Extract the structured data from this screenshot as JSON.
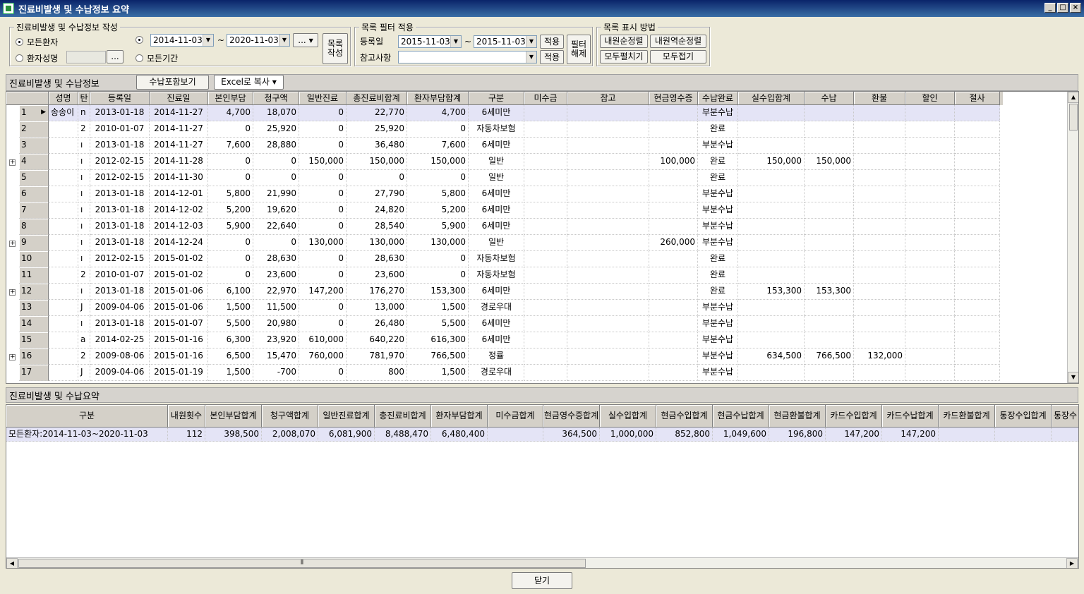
{
  "window": {
    "title": "진료비발생 및 수납정보 요약",
    "buttons": [
      "_",
      "□",
      "×"
    ]
  },
  "create_group": {
    "label": "진료비발생 및 수납정보 작성",
    "all_patients": "모든환자",
    "patient_name": "환자성명",
    "browse": "...",
    "date_from": "2014-11-03",
    "date_to": "2020-11-03",
    "tilde": "~",
    "range_btn": "...",
    "all_period": "모든기간",
    "create_btn": "목록\n작성"
  },
  "filter_group": {
    "label": "목록 필터 적용",
    "reg_label": "등록일",
    "reg_from": "2015-11-03",
    "reg_to": "2015-11-03",
    "tilde": "~",
    "apply1": "적용",
    "note_label": "참고사항",
    "note_value": "",
    "apply2": "적용",
    "clear_btn": "필터\n해제"
  },
  "display_group": {
    "label": "목록 표시 방법",
    "asc": "내원순정렬",
    "desc": "내원역순정렬",
    "expand_all": "모두펼치기",
    "collapse_all": "모두접기"
  },
  "detail_panel": {
    "title": "진료비발생 및 수납정보",
    "include_payment": "수납포함보기",
    "excel": "Excel로 복사",
    "columns": [
      "성명",
      "탄",
      "등록일",
      "진료일",
      "본인부담",
      "청구액",
      "일반진료",
      "총진료비합계",
      "환자부담합계",
      "구분",
      "미수금",
      "참고",
      "현금영수증",
      "수납완료",
      "실수입합계",
      "수납",
      "환불",
      "할인",
      "절사"
    ],
    "rows": [
      {
        "no": "1",
        "name": "송송이",
        "g": "n",
        "reg": "2013-01-18",
        "visit": "2014-11-27",
        "self": "4,700",
        "claim": "18,070",
        "general": "0",
        "total": "22,770",
        "patient": "4,700",
        "type": "6세미만",
        "unpaid": "",
        "ref": "",
        "receipt": "",
        "done": "부분수납",
        "income": "",
        "paid": "",
        "refund": "",
        "discount": "",
        "cut": "",
        "expand": false
      },
      {
        "no": "2",
        "name": "",
        "g": "2",
        "reg": "2010-01-07",
        "visit": "2014-11-27",
        "self": "0",
        "claim": "25,920",
        "general": "0",
        "total": "25,920",
        "patient": "0",
        "type": "자동차보험",
        "unpaid": "",
        "ref": "",
        "receipt": "",
        "done": "완료",
        "income": "",
        "paid": "",
        "refund": "",
        "discount": "",
        "cut": "",
        "expand": false
      },
      {
        "no": "3",
        "name": "",
        "g": "ı",
        "reg": "2013-01-18",
        "visit": "2014-11-27",
        "self": "7,600",
        "claim": "28,880",
        "general": "0",
        "total": "36,480",
        "patient": "7,600",
        "type": "6세미만",
        "unpaid": "",
        "ref": "",
        "receipt": "",
        "done": "부분수납",
        "income": "",
        "paid": "",
        "refund": "",
        "discount": "",
        "cut": "",
        "expand": false
      },
      {
        "no": "4",
        "name": "",
        "g": "ı",
        "reg": "2012-02-15",
        "visit": "2014-11-28",
        "self": "0",
        "claim": "0",
        "general": "150,000",
        "total": "150,000",
        "patient": "150,000",
        "type": "일반",
        "unpaid": "",
        "ref": "",
        "receipt": "100,000",
        "done": "완료",
        "income": "150,000",
        "paid": "150,000",
        "refund": "",
        "discount": "",
        "cut": "",
        "expand": true
      },
      {
        "no": "5",
        "name": "",
        "g": "ı",
        "reg": "2012-02-15",
        "visit": "2014-11-30",
        "self": "0",
        "claim": "0",
        "general": "0",
        "total": "0",
        "patient": "0",
        "type": "일반",
        "unpaid": "",
        "ref": "",
        "receipt": "",
        "done": "완료",
        "income": "",
        "paid": "",
        "refund": "",
        "discount": "",
        "cut": "",
        "expand": false
      },
      {
        "no": "6",
        "name": "",
        "g": "ı",
        "reg": "2013-01-18",
        "visit": "2014-12-01",
        "self": "5,800",
        "claim": "21,990",
        "general": "0",
        "total": "27,790",
        "patient": "5,800",
        "type": "6세미만",
        "unpaid": "",
        "ref": "",
        "receipt": "",
        "done": "부분수납",
        "income": "",
        "paid": "",
        "refund": "",
        "discount": "",
        "cut": "",
        "expand": false
      },
      {
        "no": "7",
        "name": "",
        "g": "ı",
        "reg": "2013-01-18",
        "visit": "2014-12-02",
        "self": "5,200",
        "claim": "19,620",
        "general": "0",
        "total": "24,820",
        "patient": "5,200",
        "type": "6세미만",
        "unpaid": "",
        "ref": "",
        "receipt": "",
        "done": "부분수납",
        "income": "",
        "paid": "",
        "refund": "",
        "discount": "",
        "cut": "",
        "expand": false
      },
      {
        "no": "8",
        "name": "",
        "g": "ı",
        "reg": "2013-01-18",
        "visit": "2014-12-03",
        "self": "5,900",
        "claim": "22,640",
        "general": "0",
        "total": "28,540",
        "patient": "5,900",
        "type": "6세미만",
        "unpaid": "",
        "ref": "",
        "receipt": "",
        "done": "부분수납",
        "income": "",
        "paid": "",
        "refund": "",
        "discount": "",
        "cut": "",
        "expand": false
      },
      {
        "no": "9",
        "name": "",
        "g": "ı",
        "reg": "2013-01-18",
        "visit": "2014-12-24",
        "self": "0",
        "claim": "0",
        "general": "130,000",
        "total": "130,000",
        "patient": "130,000",
        "type": "일반",
        "unpaid": "",
        "ref": "",
        "receipt": "260,000",
        "done": "부분수납",
        "income": "",
        "paid": "",
        "refund": "",
        "discount": "",
        "cut": "",
        "expand": true
      },
      {
        "no": "10",
        "name": "",
        "g": "ı",
        "reg": "2012-02-15",
        "visit": "2015-01-02",
        "self": "0",
        "claim": "28,630",
        "general": "0",
        "total": "28,630",
        "patient": "0",
        "type": "자동차보험",
        "unpaid": "",
        "ref": "",
        "receipt": "",
        "done": "완료",
        "income": "",
        "paid": "",
        "refund": "",
        "discount": "",
        "cut": "",
        "expand": false
      },
      {
        "no": "11",
        "name": "",
        "g": "2",
        "reg": "2010-01-07",
        "visit": "2015-01-02",
        "self": "0",
        "claim": "23,600",
        "general": "0",
        "total": "23,600",
        "patient": "0",
        "type": "자동차보험",
        "unpaid": "",
        "ref": "",
        "receipt": "",
        "done": "완료",
        "income": "",
        "paid": "",
        "refund": "",
        "discount": "",
        "cut": "",
        "expand": false
      },
      {
        "no": "12",
        "name": "",
        "g": "ı",
        "reg": "2013-01-18",
        "visit": "2015-01-06",
        "self": "6,100",
        "claim": "22,970",
        "general": "147,200",
        "total": "176,270",
        "patient": "153,300",
        "type": "6세미만",
        "unpaid": "",
        "ref": "",
        "receipt": "",
        "done": "완료",
        "income": "153,300",
        "paid": "153,300",
        "refund": "",
        "discount": "",
        "cut": "",
        "expand": true
      },
      {
        "no": "13",
        "name": "",
        "g": "J",
        "reg": "2009-04-06",
        "visit": "2015-01-06",
        "self": "1,500",
        "claim": "11,500",
        "general": "0",
        "total": "13,000",
        "patient": "1,500",
        "type": "경로우대",
        "unpaid": "",
        "ref": "",
        "receipt": "",
        "done": "부분수납",
        "income": "",
        "paid": "",
        "refund": "",
        "discount": "",
        "cut": "",
        "expand": false
      },
      {
        "no": "14",
        "name": "",
        "g": "ı",
        "reg": "2013-01-18",
        "visit": "2015-01-07",
        "self": "5,500",
        "claim": "20,980",
        "general": "0",
        "total": "26,480",
        "patient": "5,500",
        "type": "6세미만",
        "unpaid": "",
        "ref": "",
        "receipt": "",
        "done": "부분수납",
        "income": "",
        "paid": "",
        "refund": "",
        "discount": "",
        "cut": "",
        "expand": false
      },
      {
        "no": "15",
        "name": "",
        "g": "a",
        "reg": "2014-02-25",
        "visit": "2015-01-16",
        "self": "6,300",
        "claim": "23,920",
        "general": "610,000",
        "total": "640,220",
        "patient": "616,300",
        "type": "6세미만",
        "unpaid": "",
        "ref": "",
        "receipt": "",
        "done": "부분수납",
        "income": "",
        "paid": "",
        "refund": "",
        "discount": "",
        "cut": "",
        "expand": false
      },
      {
        "no": "16",
        "name": "",
        "g": "2",
        "reg": "2009-08-06",
        "visit": "2015-01-16",
        "self": "6,500",
        "claim": "15,470",
        "general": "760,000",
        "total": "781,970",
        "patient": "766,500",
        "type": "정률",
        "unpaid": "",
        "ref": "",
        "receipt": "",
        "done": "부분수납",
        "income": "634,500",
        "paid": "766,500",
        "refund": "132,000",
        "discount": "",
        "cut": "",
        "expand": true
      },
      {
        "no": "17",
        "name": "",
        "g": "J",
        "reg": "2009-04-06",
        "visit": "2015-01-19",
        "self": "1,500",
        "claim": "-700",
        "general": "0",
        "total": "800",
        "patient": "1,500",
        "type": "경로우대",
        "unpaid": "",
        "ref": "",
        "receipt": "",
        "done": "부분수납",
        "income": "",
        "paid": "",
        "refund": "",
        "discount": "",
        "cut": "",
        "expand": false
      }
    ]
  },
  "summary_panel": {
    "title": "진료비발생 및 수납요약",
    "columns": [
      "구분",
      "내원횟수",
      "본인부담합계",
      "청구액합계",
      "일반진료합계",
      "총진료비합계",
      "환자부담합계",
      "미수금합계",
      "현금영수증합계",
      "실수입합계",
      "현금수입합계",
      "현금수납합계",
      "현금환불합계",
      "카드수입합계",
      "카드수납합계",
      "카드환불합계",
      "통장수입합계",
      "통장수"
    ],
    "row": [
      "모든환자:2014-11-03~2020-11-03",
      "112",
      "398,500",
      "2,008,070",
      "6,081,900",
      "8,488,470",
      "6,480,400",
      "",
      "364,500",
      "1,000,000",
      "852,800",
      "1,049,600",
      "196,800",
      "147,200",
      "147,200",
      "",
      "",
      ""
    ]
  },
  "footer": {
    "close": "닫기"
  }
}
